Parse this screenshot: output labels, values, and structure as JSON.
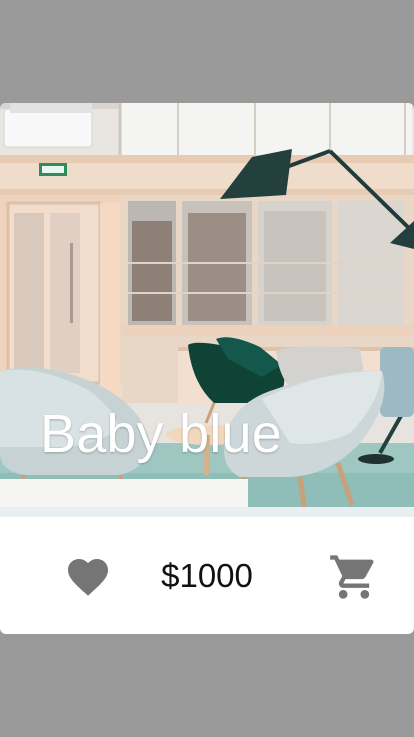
{
  "product": {
    "name": "Baby blue",
    "price": "$1000"
  },
  "actions": {
    "favorite_icon": "heart-icon",
    "cart_icon": "shopping-cart-icon"
  },
  "colors": {
    "page_background": "#9a9a9a",
    "card_background": "#ffffff",
    "icon": "#757575",
    "title_text": "#ffffff"
  }
}
